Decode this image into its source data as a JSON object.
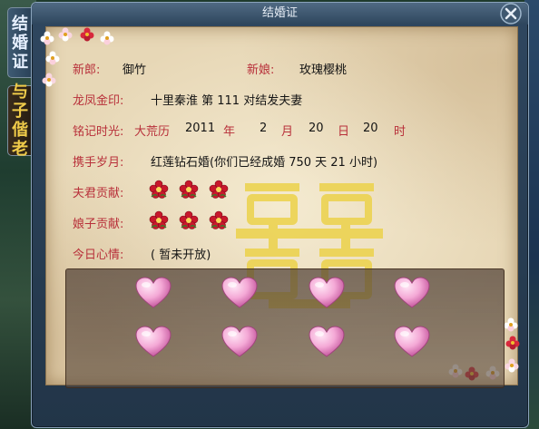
{
  "tabs": [
    {
      "chars": [
        "结",
        "婚",
        "证"
      ]
    },
    {
      "chars": [
        "与",
        "子",
        "偕",
        "老"
      ]
    }
  ],
  "window": {
    "title": "结婚证"
  },
  "certificate": {
    "groom_label": "新郎:",
    "groom_name": "御竹",
    "bride_label": "新娘:",
    "bride_name": "玫瑰樱桃",
    "seal_label": "龙凤金印:",
    "seal_text": "十里秦淮 第 111 对结发夫妻",
    "date_label": "铭记时光:",
    "date_era": "大荒历",
    "date_year": "2011",
    "date_year_unit": "年",
    "date_month": "2",
    "date_month_unit": "月",
    "date_day": "20",
    "date_day_unit": "日",
    "date_hour": "20",
    "date_hour_unit": "时",
    "years_label": "携手岁月:",
    "years_text": "红莲钻石婚(你们已经成婚 750 天 21 小时)",
    "husband_label": "夫君贡献:",
    "husband_flower_count": 3,
    "wife_label": "娘子贡献:",
    "wife_flower_count": 3,
    "mood_label": "今日心情:",
    "mood_text": "( 暂未开放)"
  },
  "hearts_count": 8,
  "colors": {
    "label_red": "#b8303a",
    "paper": "#e7d7b6",
    "heart_pink": "#f4a9d6",
    "watermark_gold": "#ecd24a"
  },
  "icons": [
    "close-icon",
    "red-flower-icon",
    "heart-icon",
    "double-happiness-icon"
  ]
}
